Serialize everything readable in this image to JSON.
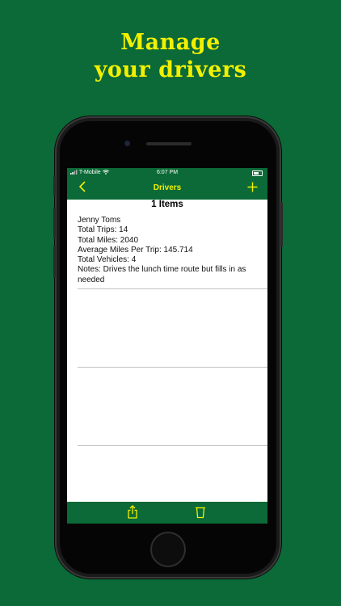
{
  "promo": {
    "headline_line1": "Manage",
    "headline_line2": "your drivers"
  },
  "status_bar": {
    "carrier": "T-Mobile",
    "time": "6:07 PM"
  },
  "nav": {
    "back_icon": "chevron-left-icon",
    "title": "Drivers",
    "add_icon": "plus-icon"
  },
  "list": {
    "count_label": "1 Items",
    "items": [
      {
        "name": "Jenny Toms",
        "total_trips": "Total Trips: 14",
        "total_miles": "Total Miles: 2040",
        "avg_miles": "Average Miles Per Trip: 145.714",
        "total_vehicles": "Total Vehicles: 4",
        "notes": "Notes: Drives the lunch time route but fills in as needed"
      }
    ]
  },
  "toolbar": {
    "share_icon": "share-icon",
    "trash_icon": "trash-icon"
  },
  "colors": {
    "brand_green": "#0b6a37",
    "accent_yellow": "#f2f000"
  }
}
